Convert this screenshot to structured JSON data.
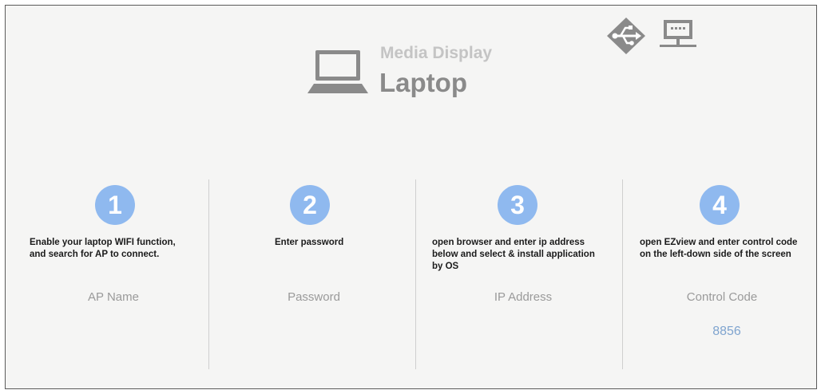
{
  "header": {
    "subtitle": "Media Display",
    "title": "Laptop",
    "icons": [
      "laptop-icon",
      "usb-icon",
      "network-icon"
    ]
  },
  "steps": [
    {
      "number": "1",
      "lines": [
        "Enable your laptop WIFI function,",
        "and search for AP to connect."
      ],
      "label": "AP Name"
    },
    {
      "number": "2",
      "lines": [
        "Enter password"
      ],
      "label": "Password"
    },
    {
      "number": "3",
      "lines": [
        "open browser and enter ip address",
        "below and select & install application",
        "by OS"
      ],
      "label": "IP Address"
    },
    {
      "number": "4",
      "lines": [
        "open EZview and enter control code",
        "on the left-down side of the screen"
      ],
      "label": "Control Code",
      "value": "8856"
    }
  ],
  "colors": {
    "accent": "#8fb9ef",
    "code": "#7fa4cf",
    "icon": "#8a8a8a",
    "background": "#f5f5f4"
  }
}
